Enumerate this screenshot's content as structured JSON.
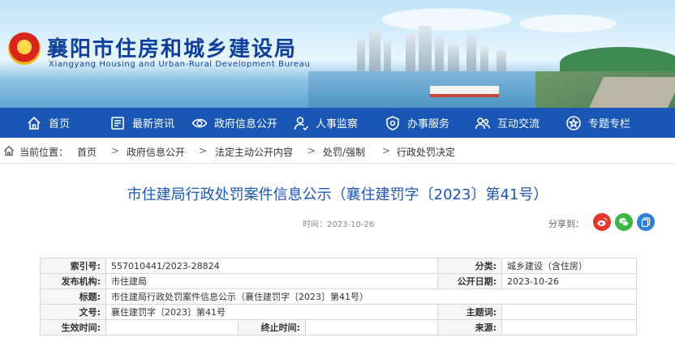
{
  "header": {
    "site_title": "襄阳市住房和城乡建设局",
    "site_subtitle": "Xiangyang Housing and Urban-Rural Development Bureau"
  },
  "nav": {
    "items": [
      {
        "label": "首页",
        "icon": "home-icon"
      },
      {
        "label": "最新资讯",
        "icon": "news-icon"
      },
      {
        "label": "政府信息公开",
        "icon": "eye-icon"
      },
      {
        "label": "人事监察",
        "icon": "person-icon"
      },
      {
        "label": "办事服务",
        "icon": "service-icon"
      },
      {
        "label": "互动交流",
        "icon": "chat-icon"
      },
      {
        "label": "专题专栏",
        "icon": "star-icon"
      }
    ]
  },
  "breadcrumb": {
    "lead": "当前位置：",
    "items": [
      "首页",
      "政府信息公开",
      "法定主动公开内容",
      "处罚/强制",
      "行政处罚决定"
    ],
    "separator": ">"
  },
  "article": {
    "title": "市住建局行政处罚案件信息公示（襄住建罚字〔2023〕第41号）",
    "time": "时间：2023-10-26",
    "share_label": "分享到："
  },
  "info_table": {
    "index_label": "索引号:",
    "index_value": "557010441/2023-28824",
    "category_label": "分类:",
    "category_value": "城乡建设（含住房）",
    "publisher_label": "发布机构:",
    "publisher_value": "市住建局",
    "pubdate_label": "公开日期:",
    "pubdate_value": "2023-10-26",
    "title_label": "标题:",
    "title_value": "市住建局行政处罚案件信息公示（襄住建罚字〔2023〕第41号）",
    "docno_label": "文号:",
    "docno_value": "襄住建罚字〔2023〕第41号",
    "subject_label": "主题词:",
    "subject_value": "",
    "effective_label": "生效时间:",
    "effective_value": "",
    "expire_label": "终止时间:",
    "expire_value": "",
    "source_label": "来源:",
    "source_value": ""
  },
  "colors": {
    "nav_bg": "#1a56b4",
    "title_blue": "#1a56b4",
    "weibo_red": "#e6362b",
    "wechat_green": "#3bb74a",
    "share_blue": "#2f7fd8"
  }
}
